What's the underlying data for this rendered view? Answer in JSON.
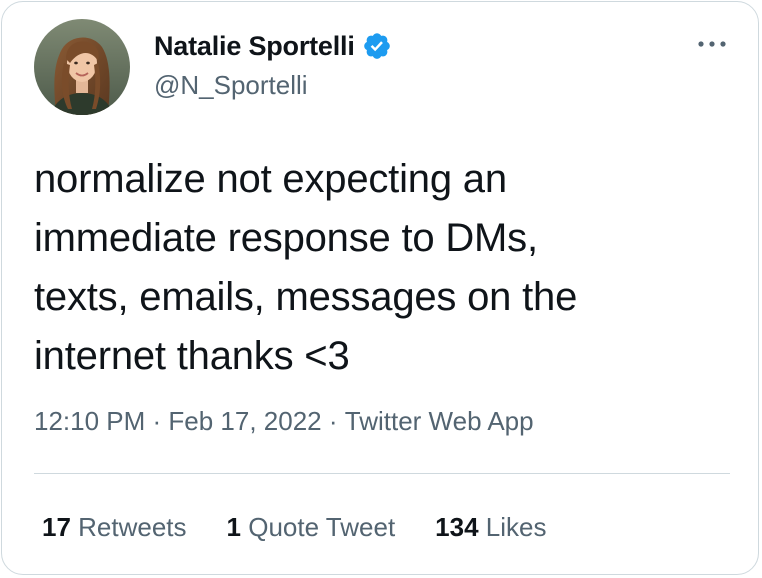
{
  "author": {
    "display_name": "Natalie Sportelli",
    "handle": "@N_Sportelli",
    "verified": true,
    "avatar_icon": "profile-photo",
    "verified_icon": "verified-badge-icon"
  },
  "tweet": {
    "text": "normalize not expecting an\nimmediate response to DMs,\ntexts, emails, messages on the\ninternet thanks <3",
    "time": "12:10 PM",
    "date": "Feb 17, 2022",
    "source": "Twitter Web App",
    "separator": " · "
  },
  "stats": {
    "retweets_count": "17",
    "retweets_label": " Retweets",
    "quotes_count": "1",
    "quotes_label": " Quote Tweet",
    "likes_count": "134",
    "likes_label": " Likes"
  },
  "colors": {
    "text_primary": "#0f1419",
    "text_secondary": "#536471",
    "verified_blue": "#1d9bf0",
    "border": "#cfd9de"
  }
}
